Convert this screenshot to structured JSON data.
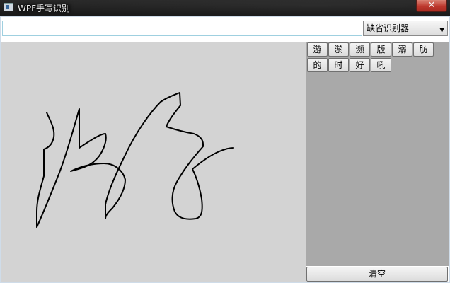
{
  "window": {
    "title": "WPF手写识别",
    "close_label": "✕"
  },
  "toolbar": {
    "result_value": "",
    "recognizer_selected": "缺省识别器"
  },
  "candidates": [
    "游",
    "淤",
    "濒",
    "版",
    "溺",
    "肪",
    "的",
    "时",
    "好",
    "吼"
  ],
  "actions": {
    "clear_label": "清空"
  },
  "colors": {
    "canvas_bg": "#d3d3d3",
    "panel_bg": "#a9a9a9",
    "ink": "#000000"
  }
}
